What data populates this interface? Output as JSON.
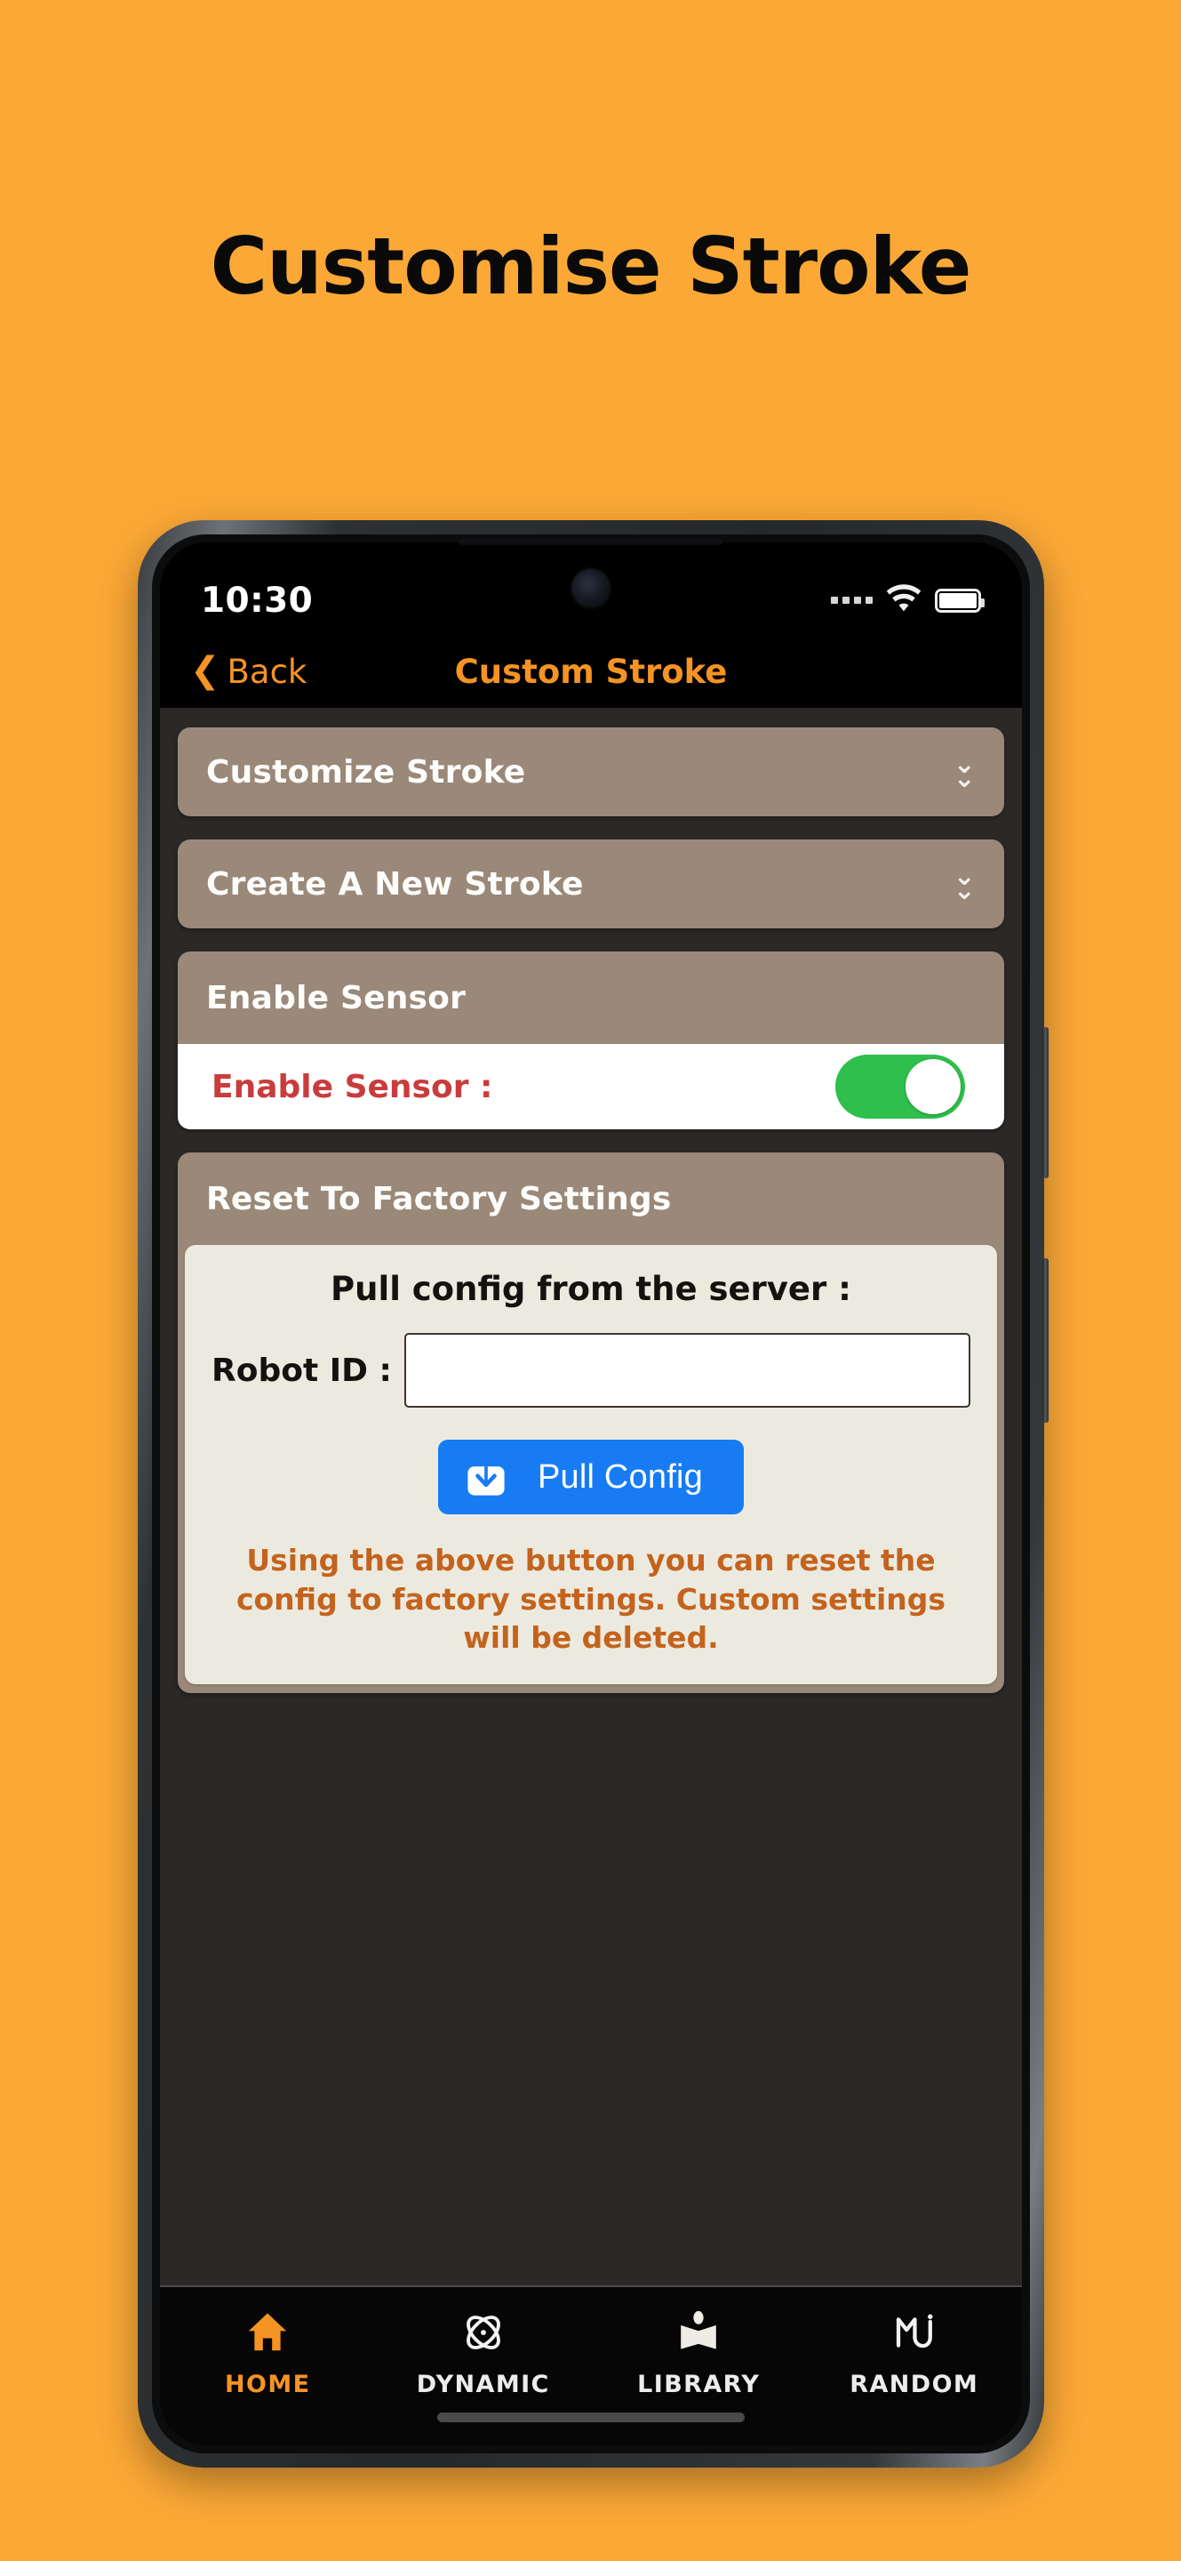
{
  "promo": {
    "title": "Customise Stroke",
    "background_color": "#fba836"
  },
  "phone": {
    "status_bar": {
      "time": "10:30",
      "signal_icon": "signal-dots-icon",
      "wifi_icon": "wifi-icon",
      "battery_icon": "battery-full-icon",
      "camera_icon": "front-camera-icon"
    },
    "nav_bar": {
      "back_label": "Back",
      "back_icon": "chevron-left-icon",
      "title": "Custom Stroke",
      "accent_color": "#f59324"
    },
    "content": {
      "sections": [
        {
          "id": "customize-stroke",
          "header": "Customize Stroke",
          "chevron_icon": "double-chevron-down-icon"
        },
        {
          "id": "create-a-new-stroke",
          "header": "Create A New Stroke",
          "chevron_icon": "double-chevron-down-icon"
        }
      ],
      "enable_sensor": {
        "header": "Enable Sensor",
        "row_label": "Enable Sensor :",
        "toggle_state": "on",
        "toggle_color": "#2fbf4c",
        "label_color": "#c93c3c"
      },
      "reset_section": {
        "header": "Reset To Factory Settings",
        "pull_title": "Pull config from the server :",
        "robot_id_label": "Robot ID :",
        "robot_id_value": "",
        "robot_id_placeholder": "",
        "pull_button_label": "Pull Config",
        "pull_button_icon": "download-icon",
        "pull_button_color": "#177cf4",
        "warning_text": "Using the above button you can reset the config to factory settings. Custom settings will be deleted.",
        "warning_color": "#c4631d"
      }
    },
    "tab_bar": {
      "tabs": [
        {
          "label": "HOME",
          "icon": "home-icon",
          "active": true
        },
        {
          "label": "DYNAMIC",
          "icon": "atom-icon",
          "active": false
        },
        {
          "label": "LIBRARY",
          "icon": "book-icon",
          "active": false
        },
        {
          "label": "RANDOM",
          "icon": "shuffle-mj-icon",
          "active": false
        }
      ]
    }
  }
}
